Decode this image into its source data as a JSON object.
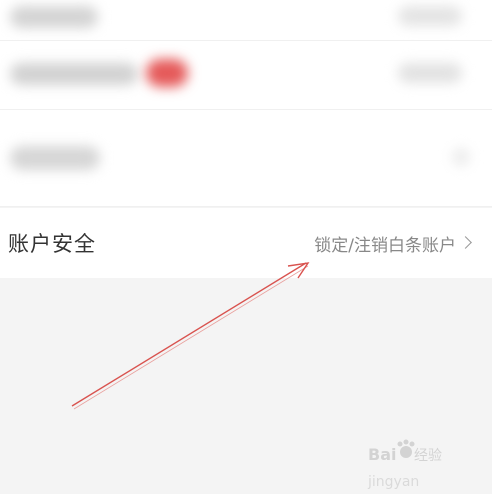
{
  "security_row": {
    "label": "账户安全",
    "action": "锁定/注销白条账户"
  },
  "icons": {
    "chevron": "chevron-right-icon",
    "watermark": "baidu-jingyan-logo"
  },
  "colors": {
    "page_background": "#f4f4f4",
    "row_background": "#ffffff",
    "label_text": "#333333",
    "action_text": "#888888",
    "annotation_arrow": "#d9534f",
    "blurred_badge": "#e55a5a"
  },
  "watermark": {
    "text": "Baidu经验"
  }
}
